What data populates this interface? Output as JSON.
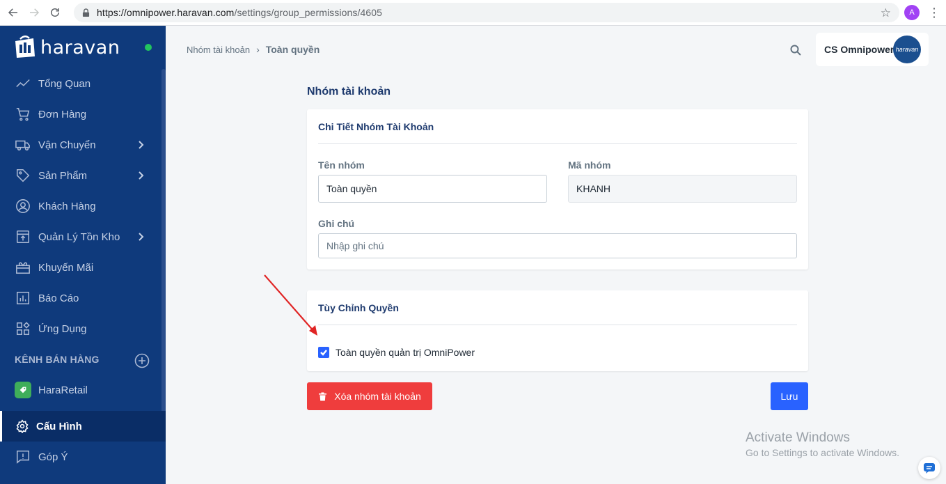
{
  "browser": {
    "url_host": "https://omnipower.haravan.com",
    "url_path": "/settings/group_permissions/4605",
    "profile_initial": "A"
  },
  "sidebar": {
    "brand": "haravan",
    "items": [
      {
        "label": "Tổng Quan",
        "icon": "trend-icon"
      },
      {
        "label": "Đơn Hàng",
        "icon": "cart-icon"
      },
      {
        "label": "Vận Chuyển",
        "icon": "truck-icon",
        "expandable": true
      },
      {
        "label": "Sản Phẩm",
        "icon": "tag-icon",
        "expandable": true
      },
      {
        "label": "Khách Hàng",
        "icon": "user-circle-icon"
      },
      {
        "label": "Quản Lý Tồn Kho",
        "icon": "warehouse-icon",
        "expandable": true
      },
      {
        "label": "Khuyến Mãi",
        "icon": "gift-icon"
      },
      {
        "label": "Báo Cáo",
        "icon": "report-icon"
      },
      {
        "label": "Ứng Dụng",
        "icon": "apps-icon"
      }
    ],
    "channels_title": "KÊNH BÁN HÀNG",
    "channel_item": "HaraRetail",
    "active_item": "Cấu Hình",
    "feedback_item": "Góp Ý"
  },
  "header": {
    "breadcrumb_parent": "Nhóm tài khoản",
    "breadcrumb_current": "Toàn quyền",
    "account_name": "CS Omnipower",
    "avatar_text": "haravan"
  },
  "main": {
    "page_title": "Nhóm tài khoản",
    "details_card": {
      "title": "Chi Tiết Nhóm Tài Khoản",
      "name_label": "Tên nhóm",
      "name_value": "Toàn quyền",
      "code_label": "Mã nhóm",
      "code_value": "KHANH",
      "note_label": "Ghi chú",
      "note_placeholder": "Nhập ghi chú"
    },
    "permissions_card": {
      "title": "Tùy Chỉnh Quyền",
      "full_access_label": "Toàn quyền quản trị OmniPower",
      "full_access_checked": true
    },
    "delete_button": "Xóa nhóm tài khoản",
    "save_button": "Lưu"
  },
  "watermark": {
    "line1": "Activate Windows",
    "line2": "Go to Settings to activate Windows."
  },
  "colors": {
    "sidebar_bg": "#0f3a7c",
    "primary": "#2962ff",
    "danger": "#ef3d3d",
    "online": "#22c55e"
  }
}
